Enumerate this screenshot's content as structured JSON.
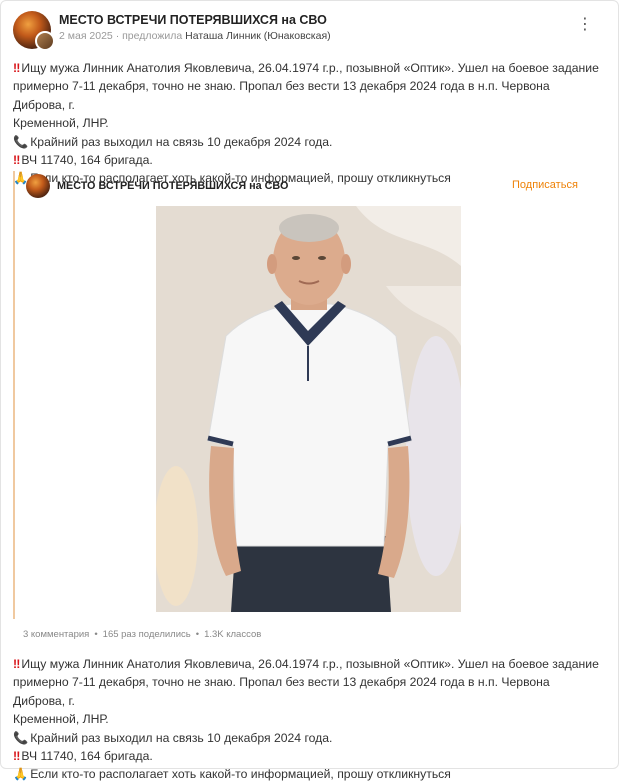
{
  "header": {
    "group_name": "МЕСТО ВСТРЕЧИ ПОТЕРЯВШИХСЯ на СВО",
    "date": "2 мая 2025",
    "suggested_label": "предложила",
    "author": "Наташа Линник (Юнаковская)",
    "menu_icon": "⋮"
  },
  "post": {
    "lines": [
      {
        "emoji": "‼",
        "text": "Ищу мужа Линник Анатолия Яковлевича, 26.04.1974 г.р., позывной «Оптик». Ушел на боевое задание"
      },
      {
        "emoji": "",
        "text": "примерно 7-11 декабря, точно не знаю. Пропал без вести 13 декабря 2024 года в н.п. Червона Диброва, г."
      },
      {
        "emoji": "",
        "text": "Кременной, ЛНР."
      },
      {
        "emoji": "📞",
        "text": "Крайний раз выходил на связь 10 декабря 2024 года."
      },
      {
        "emoji": "‼",
        "text": "ВЧ 11740, 164 бригада."
      },
      {
        "emoji": "🙏",
        "text": "Если кто-то располагает хоть какой-то информацией, прошу откликнуться"
      }
    ]
  },
  "repost": {
    "group_name": "МЕСТО ВСТРЕЧИ ПОТЕРЯВШИХСЯ на СВО",
    "subscribe_label": "Подписаться",
    "stats": {
      "comments": "3 комментария",
      "shares": "165 раз поделились",
      "classes": "1.3K классов"
    }
  },
  "post_repeat": {
    "lines": [
      {
        "emoji": "‼",
        "text": "Ищу мужа Линник Анатолия Яковлевича, 26.04.1974 г.р., позывной «Оптик». Ушел на боевое задание"
      },
      {
        "emoji": "",
        "text": "примерно 7-11 декабря, точно не знаю. Пропал без вести 13 декабря 2024 года в н.п. Червона Диброва, г."
      },
      {
        "emoji": "",
        "text": "Кременной, ЛНР."
      },
      {
        "emoji": "📞",
        "text": "Крайний раз выходил на связь 10 декабря 2024 года."
      },
      {
        "emoji": "‼",
        "text": "ВЧ 11740, 164 бригада."
      },
      {
        "emoji": "🙏",
        "text": "Если кто-то располагает хоть какой-то информацией, прошу откликнуться"
      }
    ]
  },
  "colors": {
    "accent_orange": "#ee8208",
    "repost_border": "#f0c9a0",
    "bang_red": "#d8161b"
  }
}
